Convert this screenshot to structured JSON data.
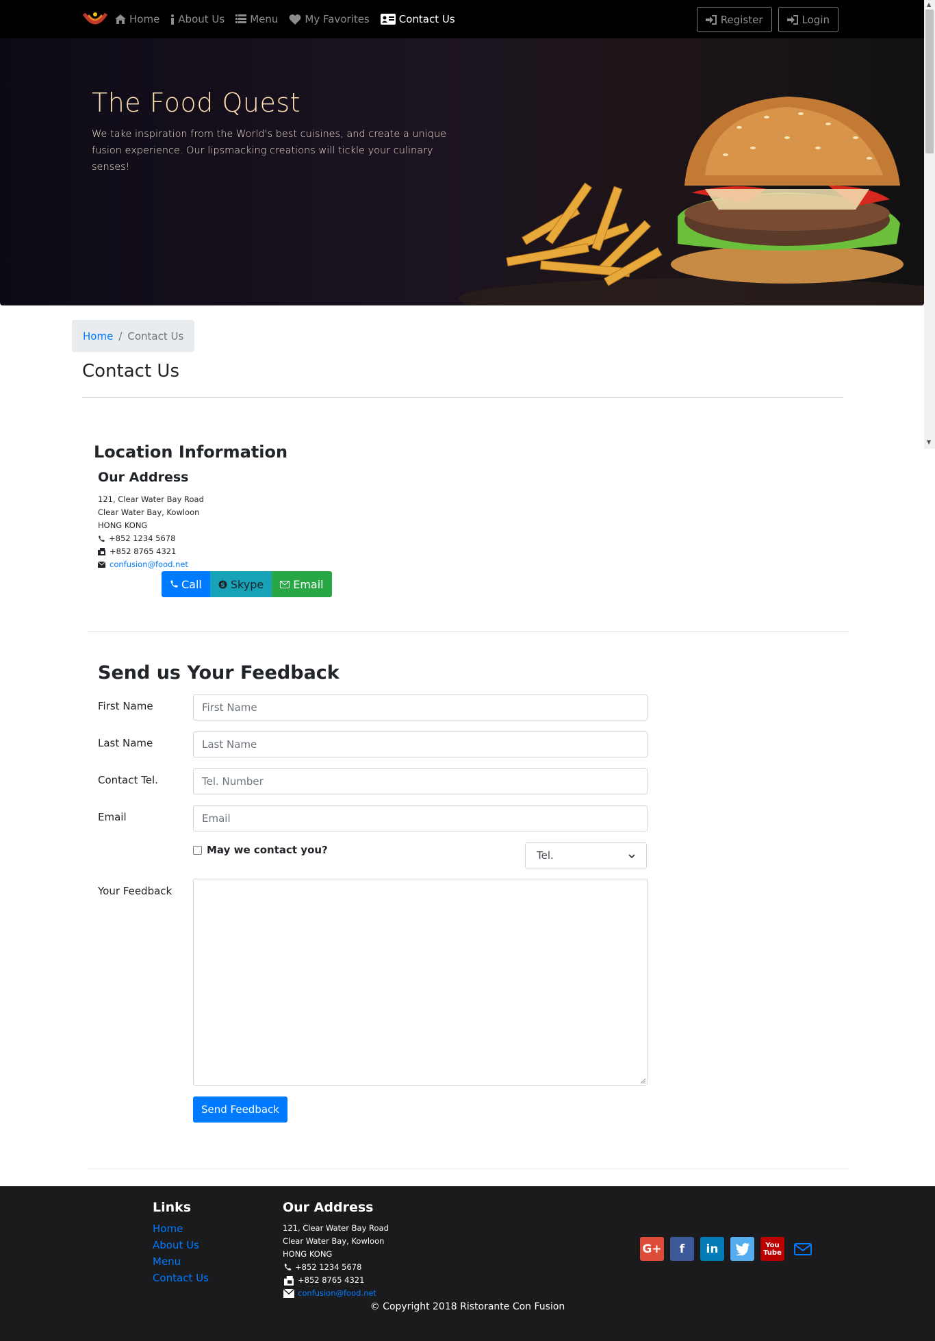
{
  "nav": {
    "items": [
      {
        "label": "Home",
        "icon": "home-icon"
      },
      {
        "label": "About Us",
        "icon": "info-icon"
      },
      {
        "label": "Menu",
        "icon": "list-icon"
      },
      {
        "label": "My Favorites",
        "icon": "heart-icon"
      },
      {
        "label": "Contact Us",
        "icon": "address-card-icon",
        "active": true
      }
    ],
    "register_label": "Register",
    "login_label": "Login"
  },
  "jumbotron": {
    "title": "The Food Quest",
    "text": "We take inspiration from the World's best cuisines, and create a unique fusion experience. Our lipsmacking creations will tickle your culinary senses!"
  },
  "breadcrumb": {
    "home": "Home",
    "current": "Contact Us"
  },
  "page_title": "Contact Us",
  "location": {
    "title": "Location Information",
    "address_title": "Our Address",
    "line1": "121, Clear Water Bay Road",
    "line2": "Clear Water Bay, Kowloon",
    "line3": "HONG KONG",
    "phone": "+852 1234 5678",
    "fax": "+852 8765 4321",
    "email": "confusion@food.net",
    "buttons": {
      "call": "Call",
      "skype": "Skype",
      "email": "Email"
    }
  },
  "feedback": {
    "title": "Send us Your Feedback",
    "first_name_label": "First Name",
    "first_name_placeholder": "First Name",
    "last_name_label": "Last Name",
    "last_name_placeholder": "Last Name",
    "tel_label": "Contact Tel.",
    "tel_placeholder": "Tel. Number",
    "email_label": "Email",
    "email_placeholder": "Email",
    "contact_check_label": "May we contact you?",
    "contact_select_value": "Tel.",
    "feedback_label": "Your Feedback",
    "submit_label": "Send Feedback"
  },
  "footer": {
    "links_title": "Links",
    "links": [
      "Home",
      "About Us",
      "Menu",
      "Contact Us"
    ],
    "address_title": "Our Address",
    "line1": "121, Clear Water Bay Road",
    "line2": "Clear Water Bay, Kowloon",
    "line3": "HONG KONG",
    "phone": "+852 1234 5678",
    "fax": "+852 8765 4321",
    "email": "confusion@food.net",
    "social": [
      "google-plus-icon",
      "facebook-icon",
      "linkedin-icon",
      "twitter-icon",
      "youtube-icon",
      "mail-icon"
    ],
    "copyright": "© Copyright 2018 Ristorante Con Fusion"
  },
  "colors": {
    "primary": "#007bff",
    "info": "#17a2b8",
    "success": "#28a745",
    "navbar_bg": "#000000",
    "footer_bg": "#1b1a1d"
  }
}
